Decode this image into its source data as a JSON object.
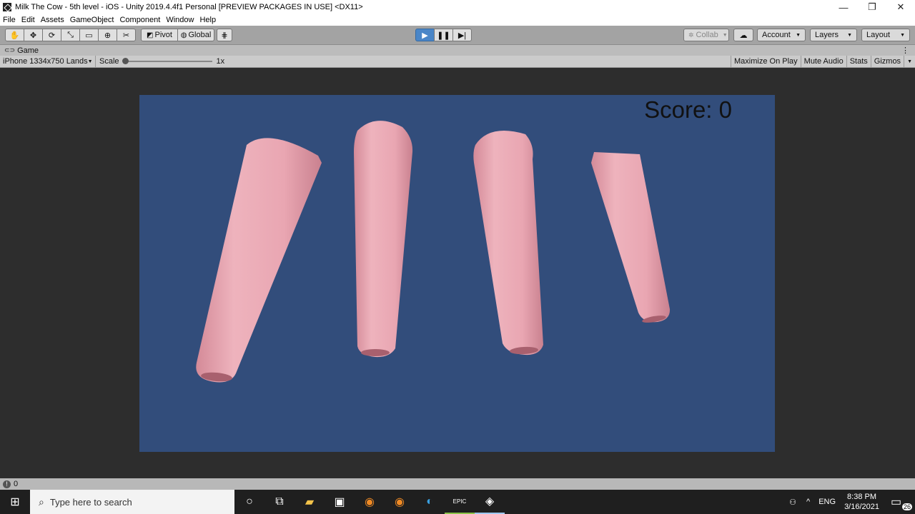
{
  "window": {
    "title": "Milk The Cow - 5th level - iOS - Unity 2019.4.4f1 Personal [PREVIEW PACKAGES IN USE] <DX11>"
  },
  "menu": [
    "File",
    "Edit",
    "Assets",
    "GameObject",
    "Component",
    "Window",
    "Help"
  ],
  "toolbar": {
    "pivot_label": "Pivot",
    "global_label": "Global",
    "collab_label": "Collab",
    "account_label": "Account",
    "layers_label": "Layers",
    "layout_label": "Layout"
  },
  "tab": {
    "label": "Game"
  },
  "game_options": {
    "resolution": "iPhone 1334x750 Lands",
    "scale_label": "Scale",
    "scale_value": "1x",
    "maximize": "Maximize On Play",
    "mute": "Mute Audio",
    "stats": "Stats",
    "gizmos": "Gizmos"
  },
  "game": {
    "score_text": "Score: 0"
  },
  "statusbar": {
    "count": "0"
  },
  "taskbar": {
    "search_placeholder": "Type here to search",
    "lang": "ENG",
    "time": "8:38 PM",
    "date": "3/16/2021",
    "notif_count": "26"
  }
}
